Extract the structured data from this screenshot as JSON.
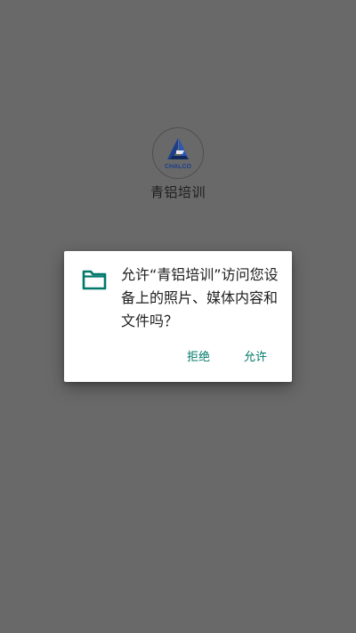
{
  "app": {
    "name": "青铝培训",
    "logo_text": "CHALCO",
    "logo_icon": "chalco-logo"
  },
  "dialog": {
    "icon": "folder-icon",
    "message": "允许“青铝培训”访问您设备上的照片、媒体内容和文件吗？",
    "deny_label": "拒绝",
    "allow_label": "允许"
  },
  "colors": {
    "scrim": "#696969",
    "accent": "#00796B",
    "logo_blue": "#1c3f8c",
    "dialog_bg": "#FFFFFF"
  }
}
